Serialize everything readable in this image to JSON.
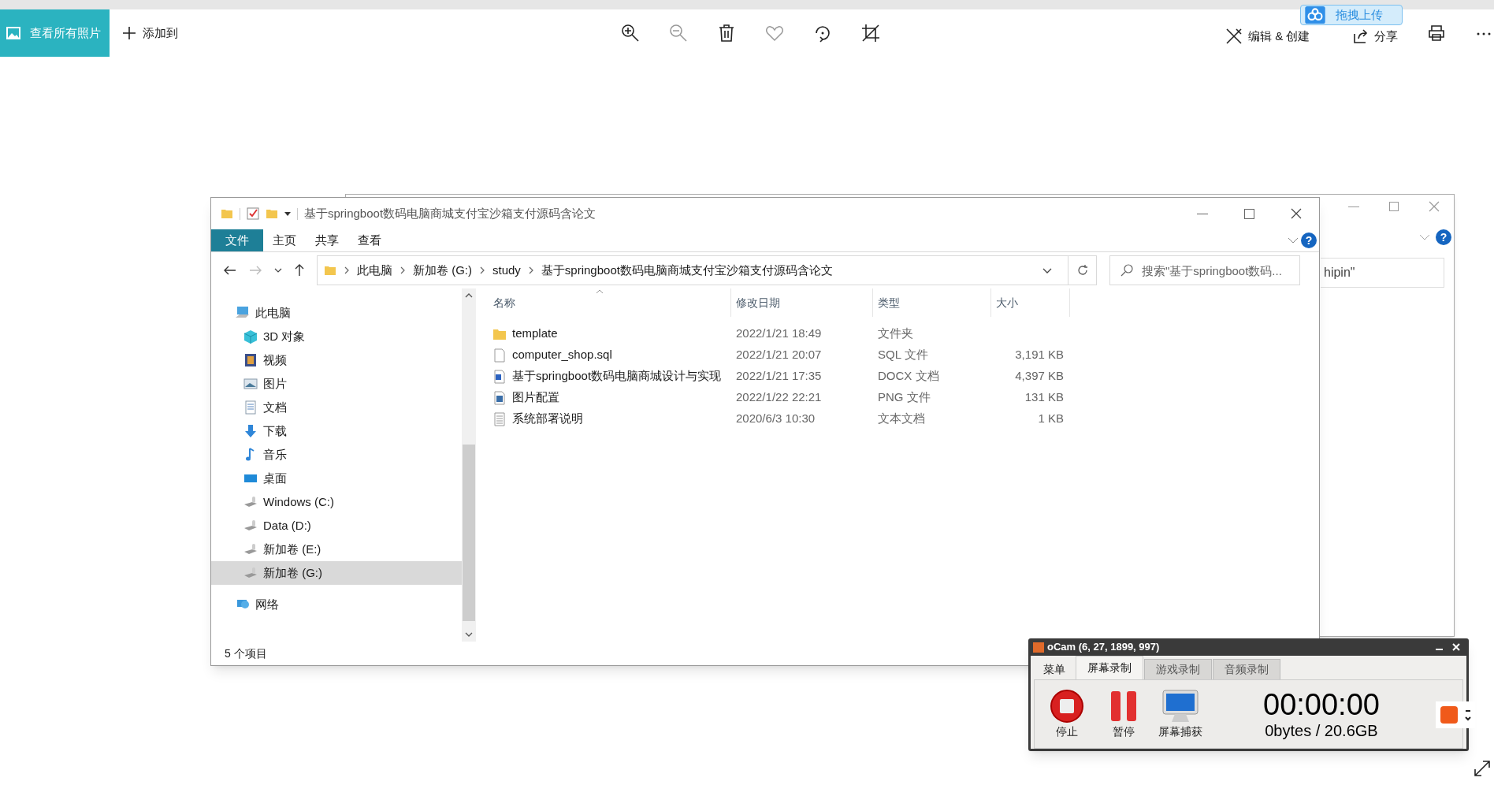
{
  "photos_toolbar": {
    "view_all_button": "查看所有照片",
    "add_button": "添加到",
    "edit_button": "编辑 & 创建",
    "share_button": "分享"
  },
  "upload_badge": {
    "label": "拖拽上传"
  },
  "background_window": {
    "help_button": "?",
    "search_text": "hipin\""
  },
  "explorer": {
    "title": "基于springboot数码电脑商城支付宝沙箱支付源码含论文",
    "ribbon_tabs": [
      {
        "label": "文件",
        "kind": "file_menu"
      },
      {
        "label": "主页",
        "kind": "tab"
      },
      {
        "label": "共享",
        "kind": "tab"
      },
      {
        "label": "查看",
        "kind": "tab"
      }
    ],
    "help_button": "?",
    "breadcrumbs": [
      "此电脑",
      "新加卷 (G:)",
      "study",
      "基于springboot数码电脑商城支付宝沙箱支付源码含论文"
    ],
    "search": {
      "placeholder": "搜索\"基于springboot数码..."
    },
    "nav_items": [
      {
        "label": "此电脑",
        "kind": "pc",
        "selected": false,
        "children": [
          {
            "label": "3D 对象",
            "kind": "cube",
            "selected": false
          },
          {
            "label": "视频",
            "kind": "video",
            "selected": false
          },
          {
            "label": "图片",
            "kind": "picture",
            "selected": false
          },
          {
            "label": "文档",
            "kind": "document",
            "selected": false
          },
          {
            "label": "下载",
            "kind": "download",
            "selected": false
          },
          {
            "label": "音乐",
            "kind": "music",
            "selected": false
          },
          {
            "label": "桌面",
            "kind": "desktop",
            "selected": false
          },
          {
            "label": "Windows (C:)",
            "kind": "drive",
            "selected": false
          },
          {
            "label": "Data (D:)",
            "kind": "drive",
            "selected": false
          },
          {
            "label": "新加卷 (E:)",
            "kind": "drive",
            "selected": false
          },
          {
            "label": "新加卷 (G:)",
            "kind": "drive",
            "selected": true
          }
        ]
      },
      {
        "label": "网络",
        "kind": "network",
        "selected": false
      }
    ],
    "columns": [
      "名称",
      "修改日期",
      "类型",
      "大小"
    ],
    "rows": [
      {
        "kind": "folder",
        "name": "template",
        "modified": "2022/1/21 18:49",
        "type": "文件夹",
        "size": ""
      },
      {
        "kind": "file",
        "name": "computer_shop.sql",
        "modified": "2022/1/21 20:07",
        "type": "SQL 文件",
        "size": "3,191 KB"
      },
      {
        "kind": "docx",
        "name": "基于springboot数码电脑商城设计与实现",
        "modified": "2022/1/21 17:35",
        "type": "DOCX 文档",
        "size": "4,397 KB"
      },
      {
        "kind": "png",
        "name": "图片配置",
        "modified": "2022/1/22 22:21",
        "type": "PNG 文件",
        "size": "131 KB"
      },
      {
        "kind": "text",
        "name": "系统部署说明",
        "modified": "2020/6/3 10:30",
        "type": "文本文档",
        "size": "1 KB"
      }
    ],
    "status": "5 个项目"
  },
  "ocam": {
    "title": "oCam (6, 27, 1899, 997)",
    "tabs": [
      {
        "label": "菜单",
        "selected": false
      },
      {
        "label": "屏幕录制",
        "selected": true
      },
      {
        "label": "游戏录制",
        "selected": false
      },
      {
        "label": "音频录制",
        "selected": false
      }
    ],
    "buttons": [
      {
        "kind": "stop",
        "label": "停止"
      },
      {
        "kind": "pause",
        "label": "暂停"
      },
      {
        "kind": "capture",
        "label": "屏幕捕获"
      }
    ],
    "timer": "00:00:00",
    "size": "0bytes / 20.6GB"
  }
}
